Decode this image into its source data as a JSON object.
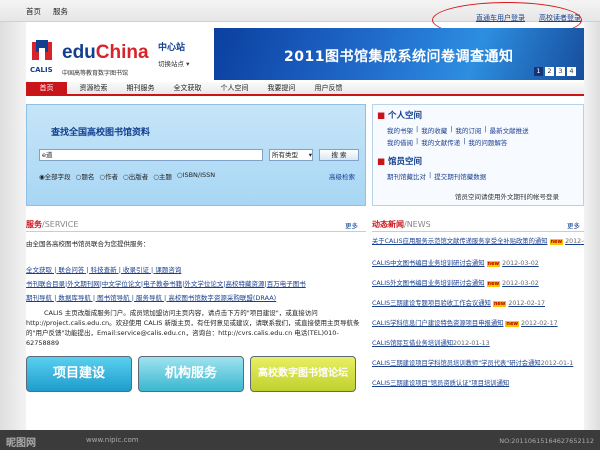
{
  "topbar": {
    "home": "首页",
    "service": "服务",
    "user_login": "直通车用户登录",
    "reader_login": "高校读者登录"
  },
  "logo": {
    "brand_a": "edu",
    "brand_b": "China",
    "calis": "CALIS",
    "sub": "中国高等教育数字图书馆"
  },
  "site": {
    "center": "中心站",
    "switch": "切换站点"
  },
  "banner": {
    "title": "2011图书馆集成系统问卷调查通知",
    "pages": [
      "1",
      "2",
      "3",
      "4"
    ]
  },
  "nav": [
    "首页",
    "资源检索",
    "期刊服务",
    "全文获取",
    "个人空间",
    "我要提问",
    "用户反馈"
  ],
  "search": {
    "heading": "查找全国高校图书馆资料",
    "value": "e道",
    "type": "所有类型",
    "button": "搜 索",
    "options": [
      "全部字段",
      "题名",
      "作者",
      "出版者",
      "主题",
      "ISBN/ISSN"
    ],
    "advanced": "高级检索"
  },
  "personal": {
    "title": "个人空间",
    "links1": [
      "我的书架",
      "我的收藏",
      "我的订阅",
      "最新文献推送"
    ],
    "links2": [
      "我的借阅",
      "我的文献传递",
      "我的问题解答"
    ],
    "staff_title": "馆员空间",
    "links3": [
      "期刊馆藏比对",
      "提交期刊馆藏数据"
    ],
    "note": "馆员空间请使用外文期刊的帐号登录"
  },
  "service": {
    "title": "服务",
    "title_en": "/SERVICE",
    "more": "更多",
    "intro": "由全国各高校图书馆员联合为您提供服务：",
    "row1": [
      "全文获取",
      "联合问答",
      "科技查新",
      "收录引证",
      "课题咨询"
    ],
    "row2": [
      "书刊联合目录",
      "外文期刊网",
      "中文学位论文",
      "电子教参书籍",
      "外文学位论文",
      "高校特藏资源",
      "百万电子图书"
    ],
    "row3": [
      "期刊导航",
      "数据库导航",
      "图书馆导航",
      "服务导航",
      "高校图书馆数字资源采购联盟(DRAA)"
    ],
    "para": "CALIS 主页改版成服务门户。成员馆加盟访问主页内容，请点击下方的\"项目建设\"，或直接访问 http://project.calis.edu.cn。欢迎使用 CALIS 新版主页，有任何意见或建议，请联系我们，或直接使用主页导航条的\"用户反馈\"功能提出，Email:service@calis.edu.cn，咨询台：http://cvrs.calis.edu.cn 电话(TEL)010-62758889"
  },
  "big_buttons": [
    "项目建设",
    "机构服务",
    "高校数字图书馆论坛"
  ],
  "news": {
    "title": "动态新闻",
    "title_en": "/NEWS",
    "more": "更多",
    "items": [
      {
        "text": "关于CALIS应用服务示范馆文献传递服务享受全补贴政策的通知",
        "new": "new",
        "date": "2012-03-02"
      },
      {
        "text": "CALIS中文图书编目业务培训研讨会通知",
        "new": "new",
        "date": "2012-03-02"
      },
      {
        "text": "CALIS外文图书编目业务培训研讨会通知",
        "new": "new",
        "date": "2012-03-02"
      },
      {
        "text": "CALIS三期建设专题项目验收工作会议通知",
        "new": "new",
        "date": "2012-02-17"
      },
      {
        "text": "CALIS学科信息门户建设特色资源项目申报通知",
        "new": "new",
        "date": "2012-02-17"
      },
      {
        "text": "CALIS馆际互借业务培训通知",
        "new": "",
        "date": "2012-01-13"
      },
      {
        "text": "CALIS三期建设项目学科馆员培训教师\"学员代表\"研讨会通知",
        "new": "",
        "date": "2012-01-1"
      },
      {
        "text": "CALIS三期建设项目\"馆员资质认证\"项目培训通知",
        "new": "",
        "date": ""
      }
    ]
  },
  "footer": {
    "logo": "昵图网",
    "url": "www.nipic.com",
    "id": "NO:20110615164627652112"
  }
}
